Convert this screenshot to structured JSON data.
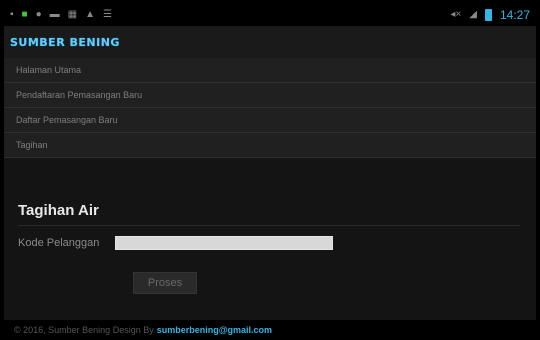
{
  "statusbar": {
    "left_icons": [
      "image-icon",
      "app-icon",
      "message-icon",
      "bbm-icon",
      "keyboard-icon",
      "warning-icon",
      "wifi-icon"
    ],
    "right_icons": [
      "mute-icon",
      "signal-icon"
    ],
    "time": "14:27"
  },
  "app": {
    "logo": "SUMBER BENING"
  },
  "menu": {
    "items": [
      {
        "label": "Halaman Utama"
      },
      {
        "label": "Pendaftaran Pemasangan Baru"
      },
      {
        "label": "Daftar Pemasangan Baru"
      },
      {
        "label": "Tagihan"
      }
    ]
  },
  "main": {
    "title": "Tagihan Air",
    "field_label": "Kode Pelanggan",
    "field_value": "",
    "submit_label": "Proses"
  },
  "footer": {
    "text": "© 2016, Sumber Bening Design By",
    "email": "sumberbening@gmail.com"
  },
  "colors": {
    "accent": "#33b5e5",
    "logo": "#5fd0ff",
    "background": "#141414"
  }
}
